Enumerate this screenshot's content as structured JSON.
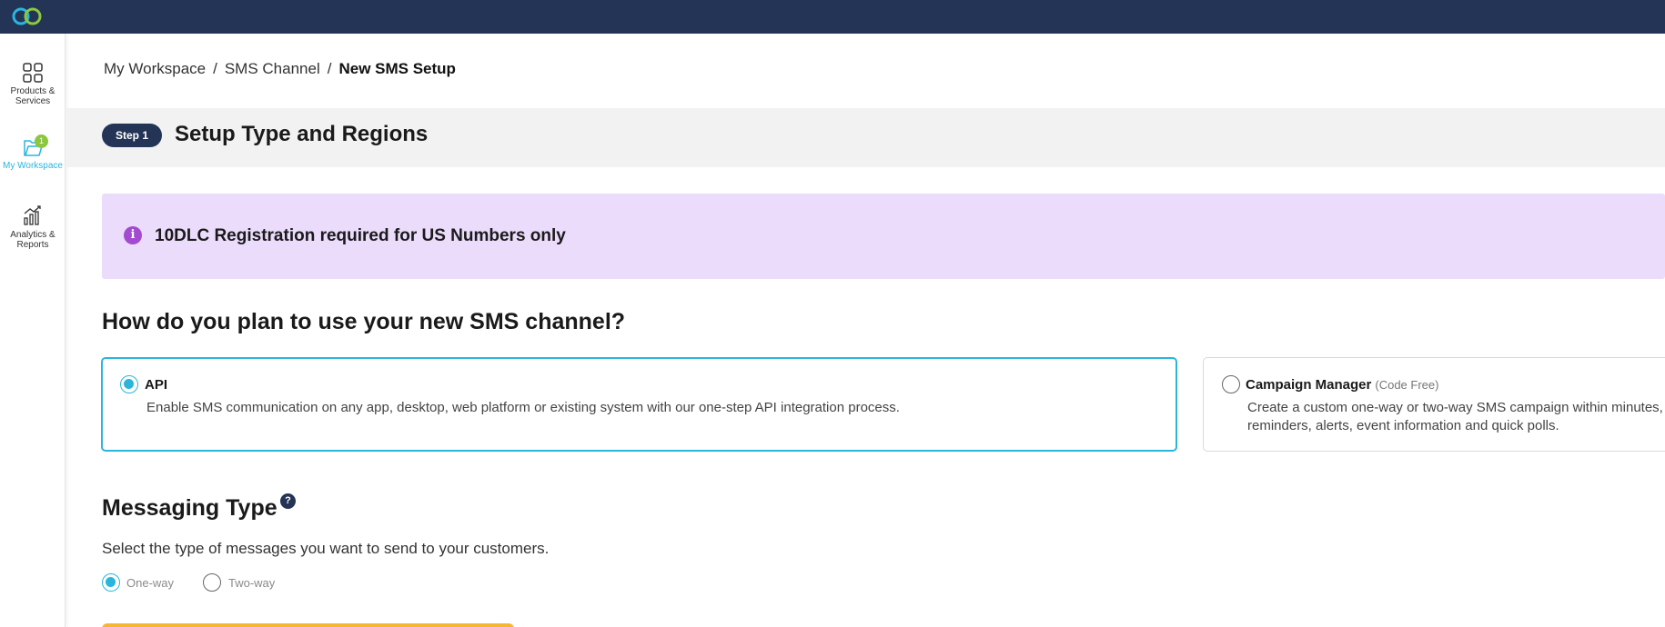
{
  "colors": {
    "topbar": "#233456",
    "accent": "#29b6dd",
    "badge": "#8dc63f",
    "info_bg": "#ebdcfc",
    "info_icon": "#a24bd0",
    "yellow": "#f5b731"
  },
  "sidebar": {
    "items": [
      {
        "label": "Products & Services",
        "icon": "grid-icon"
      },
      {
        "label": "My Workspace",
        "icon": "folder-icon",
        "badge": "1"
      },
      {
        "label": "Analytics & Reports",
        "icon": "bar-chart-icon"
      }
    ]
  },
  "breadcrumb": {
    "items": [
      "My Workspace",
      "SMS Channel",
      "New SMS Setup"
    ],
    "separator": "/"
  },
  "step": {
    "pill": "Step 1",
    "title": "Setup Type and Regions"
  },
  "info": {
    "icon": "info-icon",
    "icon_glyph": "i",
    "text": "10DLC Registration required for US Numbers only"
  },
  "usage": {
    "question": "How do you plan to use your new SMS channel?",
    "options": [
      {
        "title": "API",
        "subtitle": "",
        "desc": "Enable SMS communication on any app, desktop, web platform or existing system with our one-step API integration process.",
        "selected": true
      },
      {
        "title": "Campaign Manager",
        "subtitle": "(Code Free)",
        "desc_line1": "Create a custom one-way or two-way SMS campaign within minutes, w",
        "desc_line2": "reminders, alerts, event information and quick polls.",
        "selected": false
      }
    ]
  },
  "messaging": {
    "title": "Messaging Type",
    "help_glyph": "?",
    "desc": "Select the type of messages you want to send to your customers.",
    "options": [
      {
        "label": "One-way",
        "selected": true
      },
      {
        "label": "Two-way",
        "selected": false
      }
    ]
  }
}
